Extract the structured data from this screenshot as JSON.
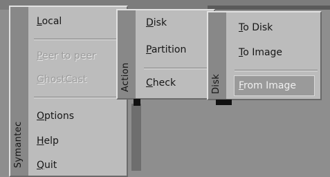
{
  "menus": {
    "main": {
      "strip_label": "Symantec",
      "items": [
        {
          "label": "Local",
          "enabled": true
        },
        {
          "label": "Peer to peer",
          "enabled": false
        },
        {
          "label": "GhostCast",
          "enabled": false
        },
        {
          "label": "Options",
          "enabled": true
        },
        {
          "label": "Help",
          "enabled": true
        },
        {
          "label": "Quit",
          "enabled": true
        }
      ]
    },
    "action": {
      "strip_label": "Action",
      "items": [
        {
          "label": "Disk",
          "enabled": true
        },
        {
          "label": "Partition",
          "enabled": true
        },
        {
          "label": "Check",
          "enabled": true
        }
      ]
    },
    "disk": {
      "strip_label": "Disk",
      "items": [
        {
          "label": "To Disk",
          "enabled": true
        },
        {
          "label": "To Image",
          "enabled": true
        },
        {
          "label": "From Image",
          "enabled": true,
          "selected": true
        }
      ]
    }
  },
  "colors": {
    "menu_background": "#bcbcbc",
    "strip_background": "#888888",
    "screen_background": "#8e8e8e"
  }
}
